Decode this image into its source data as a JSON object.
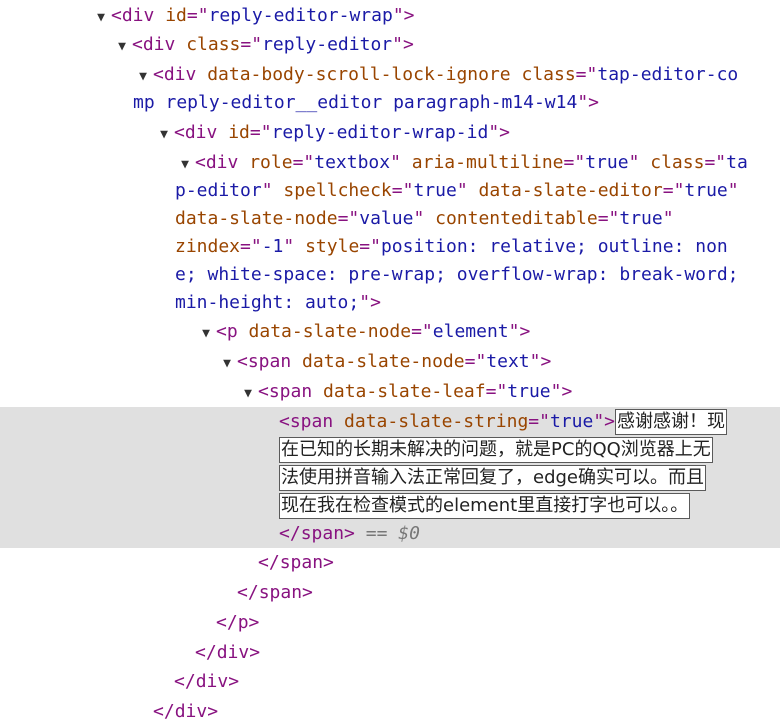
{
  "tree": {
    "l1_tag": "div",
    "l1_attr": "id",
    "l1_val": "reply-editor-wrap",
    "l2_tag": "div",
    "l2_attr": "class",
    "l2_val": "reply-editor",
    "l3_tag": "div",
    "l3_attr1": "data-body-scroll-lock-ignore",
    "l3_attr2": "class",
    "l3_val_a": "tap-editor-co",
    "l3_val_b": "mp reply-editor__editor paragraph-m14-w14",
    "l4_tag": "div",
    "l4_attr": "id",
    "l4_val": "reply-editor-wrap-id",
    "l5_tag": "div",
    "l5_role": "role",
    "l5_role_val": "textbox",
    "l5_multi": "aria-multiline",
    "l5_multi_val": "true",
    "l5_class": "class",
    "l5_class_a": "ta",
    "l5_class_b": "p-editor",
    "l5_spell": "spellcheck",
    "l5_spell_val": "true",
    "l5_slate": "data-slate-editor",
    "l5_slate_val": "true",
    "l5_node": "data-slate-node",
    "l5_node_val": "value",
    "l5_ce": "contenteditable",
    "l5_ce_val": "true",
    "l5_z": "zindex",
    "l5_z_val": "-1",
    "l5_style": "style",
    "l5_style_a": "position: relative; outline: non",
    "l5_style_b": "e; white-space: pre-wrap; overflow-wrap: break-word;",
    "l5_style_c": "min-height: auto;",
    "l6_tag": "p",
    "l6_attr": "data-slate-node",
    "l6_val": "element",
    "l7_tag": "span",
    "l7_attr": "data-slate-node",
    "l7_val": "text",
    "l8_tag": "span",
    "l8_attr": "data-slate-leaf",
    "l8_val": "true",
    "l9_tag": "span",
    "l9_attr": "data-slate-string",
    "l9_val": "true",
    "text_l1": "感谢感谢！现",
    "text_l2a": "在已知的长期未解决的问题，就是",
    "text_l2b": "PC",
    "text_l2c": "的",
    "text_l2d": "QQ",
    "text_l2e": "浏览器上无",
    "text_l3a": "法使用拼音输入法正常回复了，",
    "text_l3b": "edge",
    "text_l3c": "确实可以。而且",
    "text_l4a": "现在我在检查模式的",
    "text_l4b": "element",
    "text_l4c": "里直接打字也可以。。",
    "close_span_sel": "span",
    "selected_marker": "== $0",
    "close_span1": "span",
    "close_span2": "span",
    "close_p": "p",
    "close_div1": "div",
    "close_div2": "div",
    "close_div3": "div"
  }
}
